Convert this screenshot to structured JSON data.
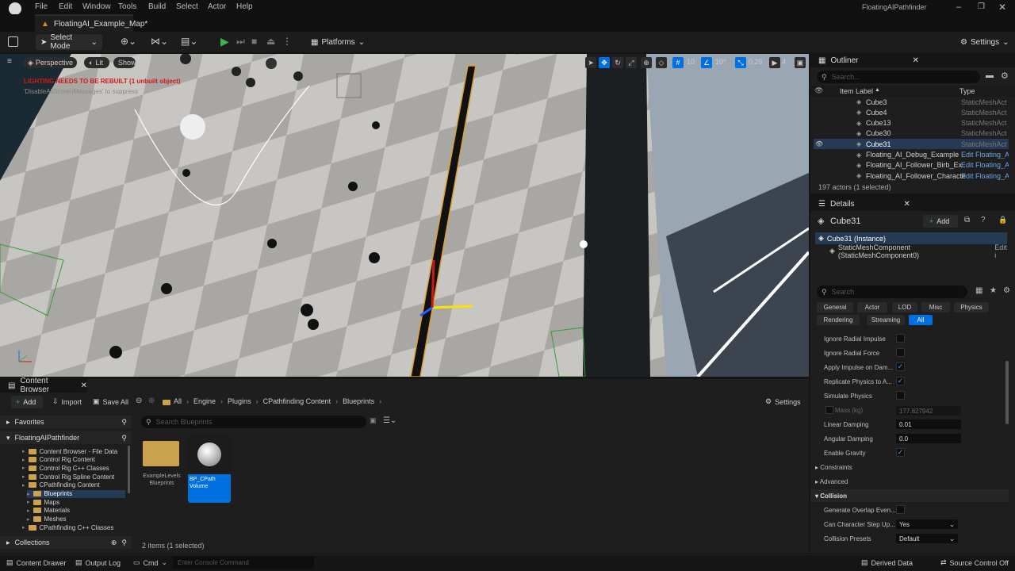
{
  "app": {
    "title": "FloatingAIPathfinder",
    "document_tab": "FloatingAI_Example_Map*"
  },
  "menu": [
    "File",
    "Edit",
    "Window",
    "Tools",
    "Build",
    "Select",
    "Actor",
    "Help"
  ],
  "toolbar": {
    "mode": "Select Mode",
    "platforms": "Platforms",
    "settings": "Settings"
  },
  "viewport": {
    "perspective": "Perspective",
    "lit": "Lit",
    "show": "Show",
    "warning": "LIGHTING NEEDS TO BE REBUILT (1 unbuilt object)",
    "warning_sub": "'DisableAllScreenMessages' to suppress",
    "grid_snap": "10",
    "rot_snap": "10°",
    "scale_snap": "0.25",
    "camera_speed": "4"
  },
  "outliner": {
    "title": "Outliner",
    "search_placeholder": "Search...",
    "col_label": "Item Label",
    "col_type": "Type",
    "rows": [
      {
        "label": "Cube3",
        "type": "StaticMeshAct"
      },
      {
        "label": "Cube4",
        "type": "StaticMeshAct"
      },
      {
        "label": "Cube13",
        "type": "StaticMeshAct"
      },
      {
        "label": "Cube30",
        "type": "StaticMeshAct"
      },
      {
        "label": "Cube31",
        "type": "StaticMeshAct",
        "selected": true
      },
      {
        "label": "Floating_AI_Debug_Example",
        "type": "Edit Floating_A"
      },
      {
        "label": "Floating_AI_Follower_Birb_Ex",
        "type": "Edit Floating_A"
      },
      {
        "label": "Floating_AI_Follower_Characte",
        "type": "Edit Floating_A"
      }
    ],
    "status": "197 actors (1 selected)"
  },
  "details": {
    "title": "Details",
    "object": "Cube31",
    "add": "Add",
    "instance": "Cube31 (Instance)",
    "component": "StaticMeshComponent (StaticMeshComponent0)",
    "component_edit": "Edit i",
    "search_placeholder": "Search",
    "filters": [
      "General",
      "Actor",
      "LOD",
      "Misc",
      "Physics"
    ],
    "filters2": [
      "Rendering",
      "Streaming",
      "All"
    ],
    "props": [
      {
        "label": "Ignore Radial Impulse",
        "kind": "check",
        "checked": false
      },
      {
        "label": "Ignore Radial Force",
        "kind": "check",
        "checked": false
      },
      {
        "label": "Apply Impulse on Dam...",
        "kind": "check",
        "checked": true
      },
      {
        "label": "Replicate Physics to A...",
        "kind": "check",
        "checked": true
      },
      {
        "label": "Simulate Physics",
        "kind": "check",
        "checked": false
      }
    ],
    "mass_label": "Mass (kg)",
    "mass_value": "177.827942",
    "linear_damping_label": "Linear Damping",
    "linear_damping": "0.01",
    "angular_damping_label": "Angular Damping",
    "angular_damping": "0.0",
    "gravity_label": "Enable Gravity",
    "constraints": "Constraints",
    "advanced": "Advanced",
    "collision": "Collision",
    "overlap_label": "Generate Overlap Even...",
    "step_label": "Can Character Step Up...",
    "step_value": "Yes",
    "presets_label": "Collision Presets",
    "presets_value": "Default"
  },
  "content_browser": {
    "title": "Content Browser",
    "add": "Add",
    "import": "Import",
    "save_all": "Save All",
    "path": [
      "All",
      "Engine",
      "Plugins",
      "CPathfinding Content",
      "Blueprints"
    ],
    "settings": "Settings",
    "favorites": "Favorites",
    "project": "FloatingAIPathfinder",
    "tree": [
      {
        "label": "Content Browser - File Data",
        "indent": 1
      },
      {
        "label": "Control Rig Content",
        "indent": 1
      },
      {
        "label": "Control Rig C++ Classes",
        "indent": 1
      },
      {
        "label": "Control Rig Spline Content",
        "indent": 1
      },
      {
        "label": "CPathfinding Content",
        "indent": 1
      },
      {
        "label": "Blueprints",
        "indent": 2,
        "selected": true
      },
      {
        "label": "Maps",
        "indent": 2
      },
      {
        "label": "Materials",
        "indent": 2
      },
      {
        "label": "Meshes",
        "indent": 2
      },
      {
        "label": "CPathfinding C++ Classes",
        "indent": 1
      }
    ],
    "collections": "Collections",
    "search_placeholder": "Search Blueprints",
    "assets": [
      {
        "label": "ExampleLevels Blueprints"
      },
      {
        "label": "BP_CPath Volume",
        "selected": true
      }
    ],
    "status": "2 items (1 selected)"
  },
  "statusbar": {
    "content_drawer": "Content Drawer",
    "output_log": "Output Log",
    "cmd": "Cmd",
    "console_placeholder": "Enter Console Command",
    "derived_data": "Derived Data",
    "source_control": "Source Control Off"
  },
  "colors": {
    "accent": "#0070e0",
    "selected": "#253b55",
    "warning": "#d01818"
  }
}
